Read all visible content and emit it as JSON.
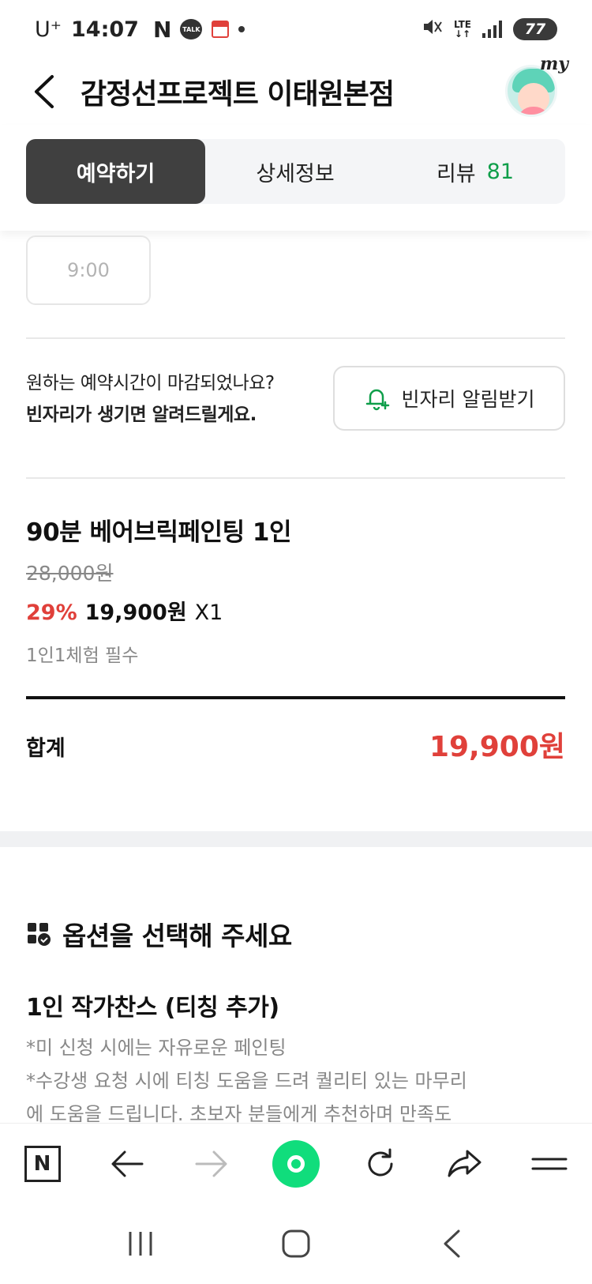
{
  "status_bar": {
    "carrier": "U⁺",
    "time": "14:07",
    "notification_n": "N",
    "talk_badge": "TALK",
    "network": "LTE",
    "battery": "77"
  },
  "header": {
    "title": "감정선프로젝트 이태원본점",
    "avatar_label": "my"
  },
  "tabs": [
    {
      "label": "예약하기",
      "active": true
    },
    {
      "label": "상세정보",
      "active": false
    },
    {
      "label": "리뷰",
      "count": "81",
      "active": false
    }
  ],
  "time_slot": {
    "label": "9:00"
  },
  "alert": {
    "line1": "원하는 예약시간이 마감되었나요?",
    "line2": "빈자리가 생기면 알려드릴게요.",
    "button_label": "빈자리 알림받기",
    "accent": "#0f9e4a"
  },
  "product": {
    "name": "90분 베어브릭페인팅 1인",
    "original_price": "28,000원",
    "discount": "29%",
    "sale_price": "19,900원",
    "quantity": "X1",
    "notice": "1인1체험 필수"
  },
  "total": {
    "label": "합계",
    "value": "19,900원",
    "color": "#e0403a"
  },
  "options": {
    "title": "옵션을 선택해 주세요",
    "item_name": "1인 작가찬스 (티칭 추가)",
    "desc_line1": "*미 신청 시에는 자유로운 페인팅",
    "desc_line2": "*수강생 요청 시에 티칭 도움을 드려 퀄리티 있는 마무리",
    "desc_line3": "에 도움을 드립니다. 초보자 분들에게 추천하며 만족도"
  },
  "browser_bar": {
    "home_label": "N",
    "icons": [
      "naver-home-icon",
      "back-arrow-icon",
      "forward-arrow-icon",
      "green-dot-icon",
      "refresh-icon",
      "share-icon",
      "menu-icon"
    ]
  },
  "system_nav": {
    "icons": [
      "recent-apps-icon",
      "home-icon",
      "back-icon"
    ]
  }
}
